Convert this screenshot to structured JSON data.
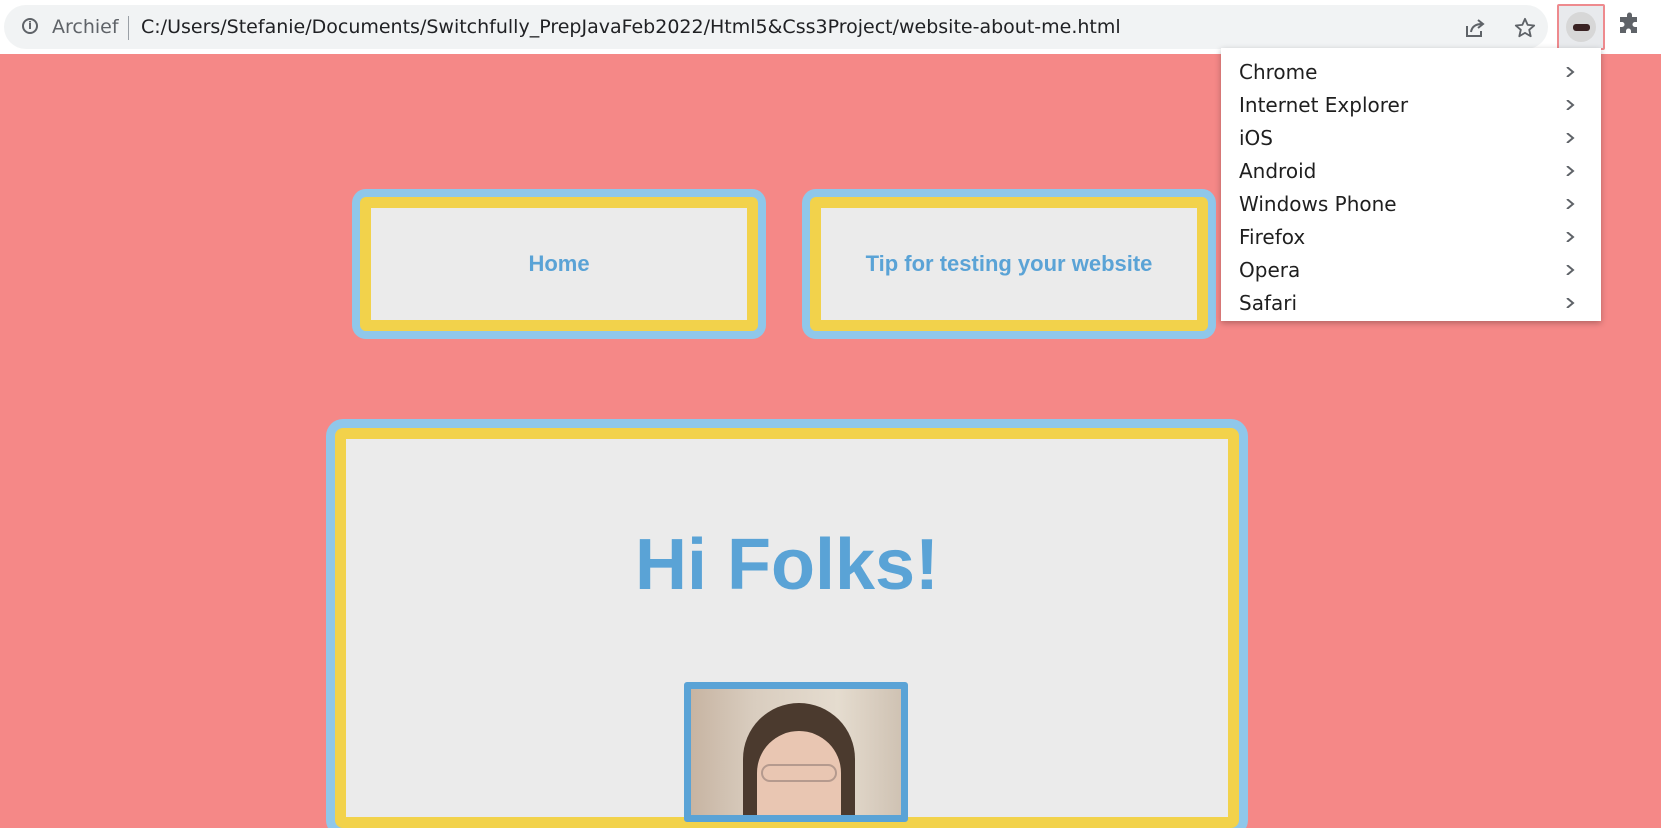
{
  "browser": {
    "site_chip": "Archief",
    "url": "C:/Users/Stefanie/Documents/Switchfully_PrepJavaFeb2022/Html5&Css3Project/website-about-me.html",
    "icons": [
      "info-icon",
      "share-icon",
      "star-icon",
      "user-agent-switcher-icon",
      "puzzle-icon"
    ],
    "extension_highlight_color": "#ee8a8e"
  },
  "menu": {
    "items": [
      {
        "label": "Chrome"
      },
      {
        "label": "Internet Explorer"
      },
      {
        "label": "iOS"
      },
      {
        "label": "Android"
      },
      {
        "label": "Windows Phone"
      },
      {
        "label": "Firefox"
      },
      {
        "label": "Opera"
      },
      {
        "label": "Safari"
      }
    ]
  },
  "page": {
    "nav": {
      "home_label": "Home",
      "tip_label": "Tip for testing your website"
    },
    "title": "Hi Folks!",
    "colors": {
      "background": "#f58887",
      "box": "#ebebeb",
      "inner_border": "#f2d24b",
      "outer_border": "#8fc7ea",
      "text": "#5aa3d6"
    }
  }
}
